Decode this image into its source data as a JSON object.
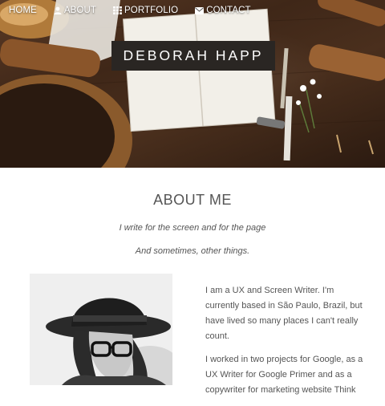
{
  "nav": {
    "home": "HOME",
    "about": "ABOUT",
    "portfolio": "PORTFOLIO",
    "contact": "CONTACT"
  },
  "brand": {
    "name": "DEBORAH HAPP"
  },
  "about": {
    "title": "ABOUT ME",
    "tagline1": "I write for the screen and for the page",
    "tagline2": "And sometimes, other things.",
    "bio1": "I am a UX and Screen Writer. I'm currently based in São Paulo, Brazil, but have lived so many places I can't really count.",
    "bio2": "I worked in two projects for Google, as a UX Writer for Google Primer and as a copywriter for marketing website Think"
  },
  "icons": {
    "about": "user-icon",
    "portfolio": "grid-icon",
    "contact": "envelope-icon"
  },
  "colors": {
    "brand_bg": "#2a2623",
    "text": "#555555",
    "nav_text": "#ffffff"
  }
}
